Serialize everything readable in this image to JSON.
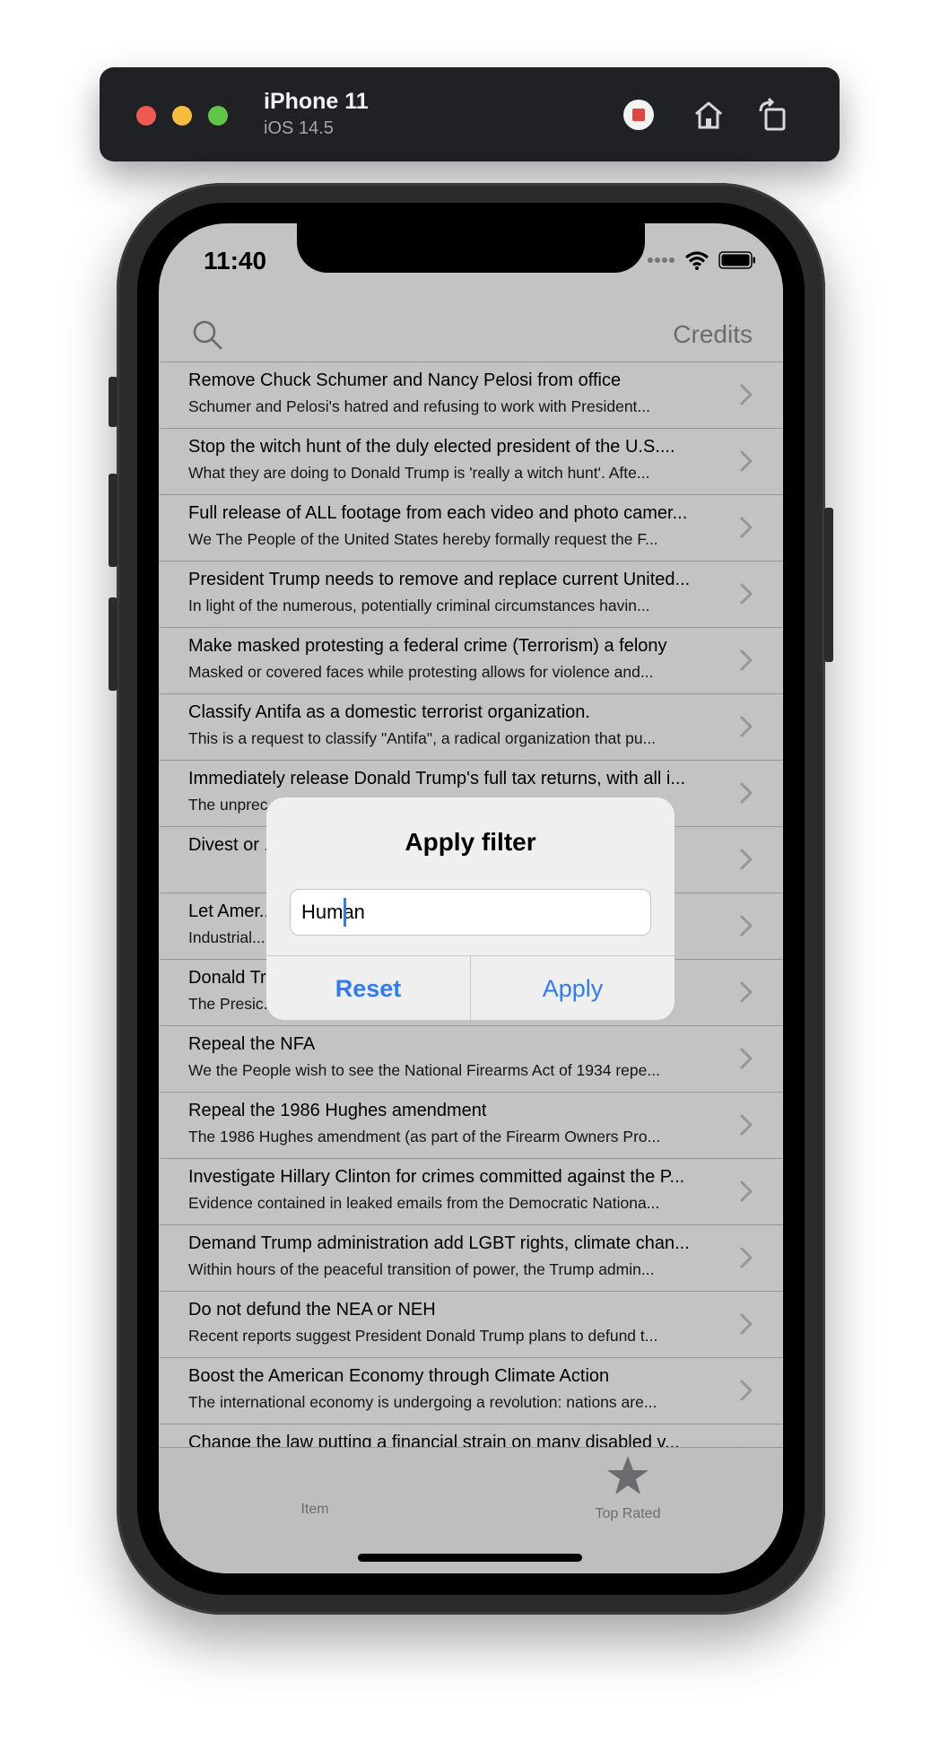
{
  "simulator": {
    "device_name": "iPhone 11",
    "os_version": "iOS 14.5"
  },
  "status_bar": {
    "time": "11:40"
  },
  "nav": {
    "credits_label": "Credits"
  },
  "list": {
    "items": [
      {
        "title": "Remove Chuck Schumer and Nancy Pelosi from office",
        "subtitle": "Schumer and Pelosi's hatred and refusing to work with President..."
      },
      {
        "title": "Stop the witch hunt of the duly elected president of the U.S....",
        "subtitle": "What they are doing to Donald Trump is 'really a witch hunt'.  Afte..."
      },
      {
        "title": "Full release of ALL footage from each video and photo camer...",
        "subtitle": "We The People of the United States hereby formally request the F..."
      },
      {
        "title": "President Trump needs to remove and replace current United...",
        "subtitle": "In light of the numerous, potentially criminal circumstances havin..."
      },
      {
        "title": "Make masked protesting a federal crime (Terrorism) a felony",
        "subtitle": "Masked or covered faces while protesting allows for violence and..."
      },
      {
        "title": "Classify Antifa as a domestic terrorist organization.",
        "subtitle": "This is a request to classify \"Antifa\", a radical organization that pu..."
      },
      {
        "title": "Immediately release Donald Trump's full tax returns, with all i...",
        "subtitle": "The unprec..."
      },
      {
        "title": "Divest or ...",
        "subtitle": ""
      },
      {
        "title": "Let Amer...",
        "subtitle": "Industrial..."
      },
      {
        "title": "Donald Tr...",
        "subtitle": "The Presic..."
      },
      {
        "title": "Repeal the NFA",
        "subtitle": "We the People wish to see the National Firearms Act of 1934 repe..."
      },
      {
        "title": "Repeal the 1986 Hughes amendment",
        "subtitle": "The 1986 Hughes amendment (as part of the Firearm Owners Pro..."
      },
      {
        "title": "Investigate Hillary Clinton for crimes committed against the P...",
        "subtitle": "Evidence contained in leaked emails from the Democratic Nationa..."
      },
      {
        "title": "Demand Trump administration add LGBT rights, climate chan...",
        "subtitle": "Within hours of the peaceful transition of power, the Trump admin..."
      },
      {
        "title": "Do not defund the NEA or NEH",
        "subtitle": "Recent reports suggest President Donald Trump plans to defund t..."
      },
      {
        "title": "Boost the American Economy through Climate Action",
        "subtitle": "The international economy is undergoing a revolution: nations are..."
      },
      {
        "title": "Change the law putting a financial strain on many disabled v...",
        "subtitle": ""
      }
    ]
  },
  "tabbar": {
    "tabs": [
      {
        "label": "Item",
        "icon": "none"
      },
      {
        "label": "Top Rated",
        "icon": "star-icon"
      }
    ]
  },
  "alert": {
    "title": "Apply filter",
    "field_value": "Human",
    "reset_label": "Reset",
    "apply_label": "Apply"
  },
  "colors": {
    "accent": "#2f7cf6",
    "toolbar_bg": "#1f2124",
    "separator": "#c6c6c8"
  }
}
